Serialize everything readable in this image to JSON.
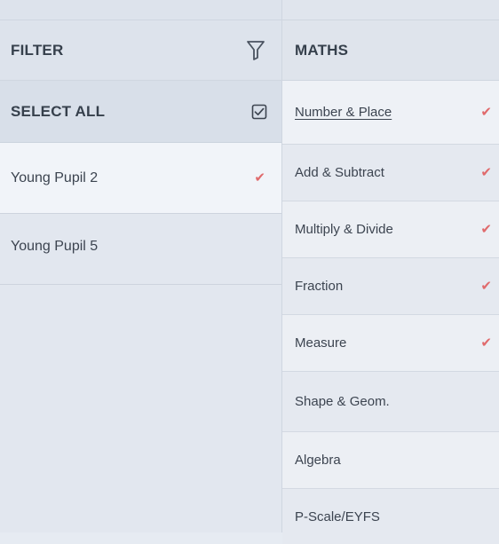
{
  "filter_panel": {
    "title": "FILTER",
    "select_all_label": "SELECT ALL",
    "pupils": [
      {
        "name": "Young Pupil 2",
        "selected": true
      },
      {
        "name": "Young Pupil 5",
        "selected": false
      }
    ]
  },
  "subject_panel": {
    "title": "MATHS",
    "topics": [
      {
        "label": "Number & Place",
        "checked": true
      },
      {
        "label": "Add & Subtract",
        "checked": true
      },
      {
        "label": "Multiply & Divide",
        "checked": true
      },
      {
        "label": "Fraction",
        "checked": true
      },
      {
        "label": "Measure",
        "checked": true
      },
      {
        "label": "Shape & Geom.",
        "checked": false
      },
      {
        "label": "Algebra",
        "checked": false
      },
      {
        "label": "P-Scale/EYFS",
        "checked": false
      }
    ]
  },
  "icons": {
    "filter": "filter-funnel-icon",
    "select_all": "checkbox-checked-icon",
    "tick": "check-mark-icon"
  },
  "colors": {
    "tick": "#e06a6c",
    "panel_bg": "#e2e7ef",
    "selected_row_bg": "#f1f4f9",
    "text": "#3c4450"
  }
}
